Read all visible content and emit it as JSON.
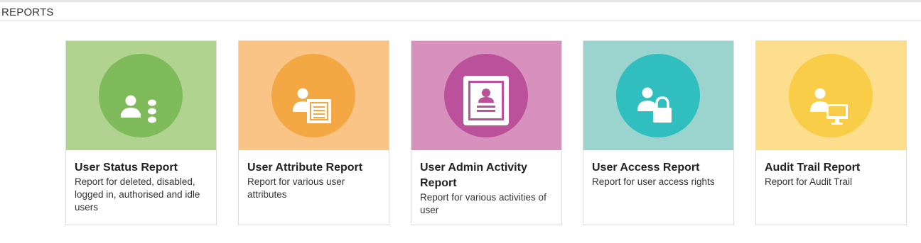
{
  "header": {
    "title": "REPORTS"
  },
  "cards": [
    {
      "title": "User Status Report",
      "description": "Report for deleted, disabled, logged in, authorised and idle users",
      "icon": "user-status-icon",
      "banner_color": "#b0d48f",
      "circle_color": "#80bb5b"
    },
    {
      "title": "User Attribute Report",
      "description": "Report for various user attributes",
      "icon": "user-attribute-icon",
      "banner_color": "#f9c486",
      "circle_color": "#f4a843"
    },
    {
      "title": "User Admin Activity Report",
      "description": "Report for various activities of user",
      "icon": "user-profile-document-icon",
      "banner_color": "#d890bd",
      "circle_color": "#bb519a"
    },
    {
      "title": "User Access Report",
      "description": "Report for user access rights",
      "icon": "user-lock-icon",
      "banner_color": "#9bd3cf",
      "circle_color": "#30bfbe"
    },
    {
      "title": "Audit Trail Report",
      "description": "Report for Audit Trail",
      "icon": "user-computer-icon",
      "banner_color": "#fcde8d",
      "circle_color": "#f9cd47"
    }
  ]
}
